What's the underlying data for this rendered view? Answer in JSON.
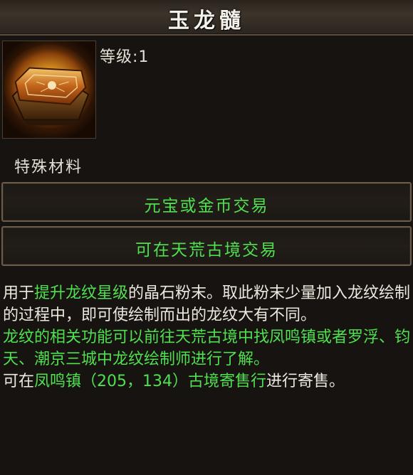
{
  "item": {
    "name": "玉龙髓",
    "level_label": "等级:1",
    "category": "特殊材料",
    "icon": "treasure-chest-icon"
  },
  "trade": {
    "line1": "元宝或金币交易",
    "line2": "可在天荒古境交易"
  },
  "description": {
    "p1_a": "用于",
    "p1_hl": "提升龙纹星级",
    "p1_b": "的晶石粉末。取此粉末少量加入龙纹绘制的过程中，即可使绘制而出的龙纹大有不同。",
    "p2": "龙纹的相关功能可以前往天荒古境中找凤鸣镇或者罗浮、钧天、潮京三城中龙纹绘制师进行了解。",
    "p3_a": "可在",
    "p3_hl": "凤鸣镇（205，134）古境寄售行",
    "p3_b": "进行寄售。"
  },
  "colors": {
    "highlight_green": "#4fe04f",
    "text": "#ece8e0",
    "background": "#171310"
  }
}
